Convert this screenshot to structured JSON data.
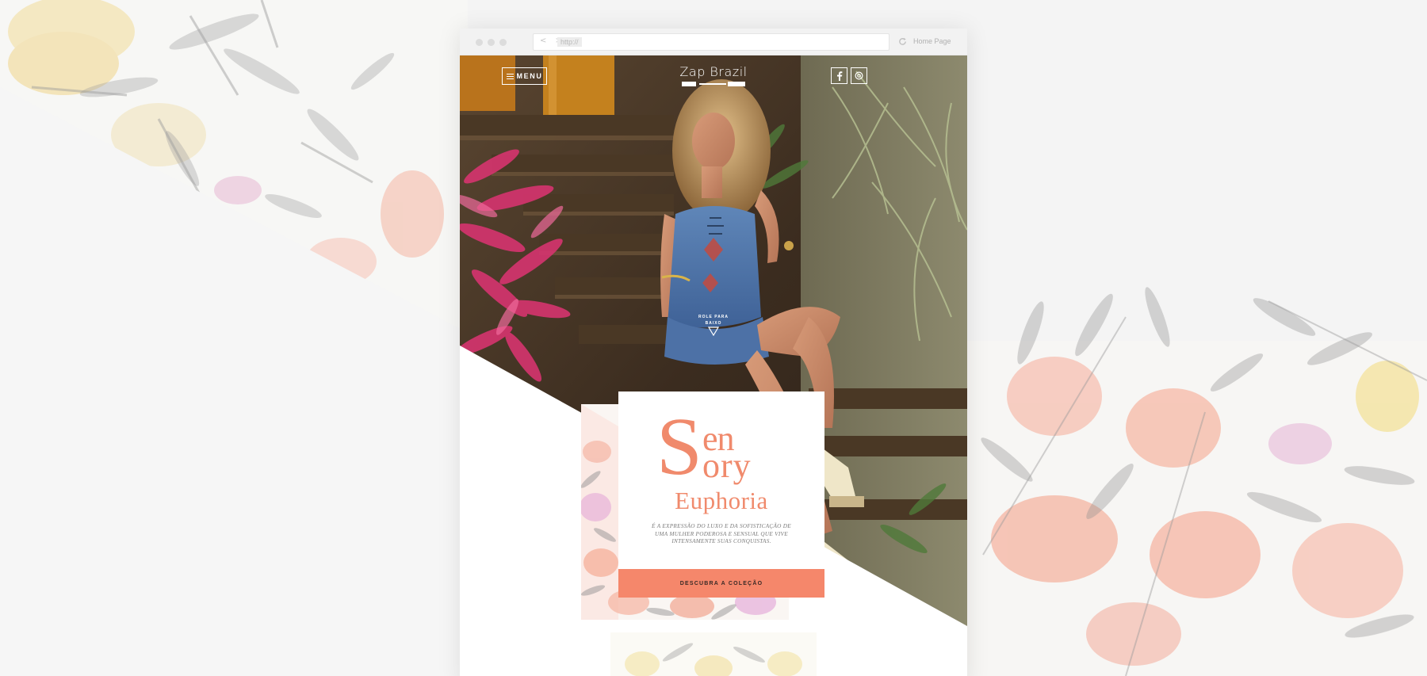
{
  "browser": {
    "url_placeholder": "http://",
    "home_label": "Home Page",
    "nav_arrows": "< >"
  },
  "site": {
    "menu_label": "MENU",
    "logo": "Zap Brazil",
    "social": [
      "facebook-icon",
      "instagram-icon"
    ],
    "scroll_hint": [
      "ROLE PARA",
      "BAIXO"
    ]
  },
  "collection": {
    "title_s": "S",
    "title_en": "en",
    "title_ory": "ory",
    "title_euphoria": "Euphoria",
    "description": "É A EXPRESSÃO DO LUXO E DA SOFISTICAÇÃO DE UMA MULHER PODEROSA E SENSUAL QUE VIVE INTENSAMENTE SUAS CONQUISTAS.",
    "cta_label": "DESCUBRA A COLEÇÃO"
  },
  "colors": {
    "accent": "#f5876b",
    "title": "#f08a6c",
    "background": "#f4f4f4"
  }
}
